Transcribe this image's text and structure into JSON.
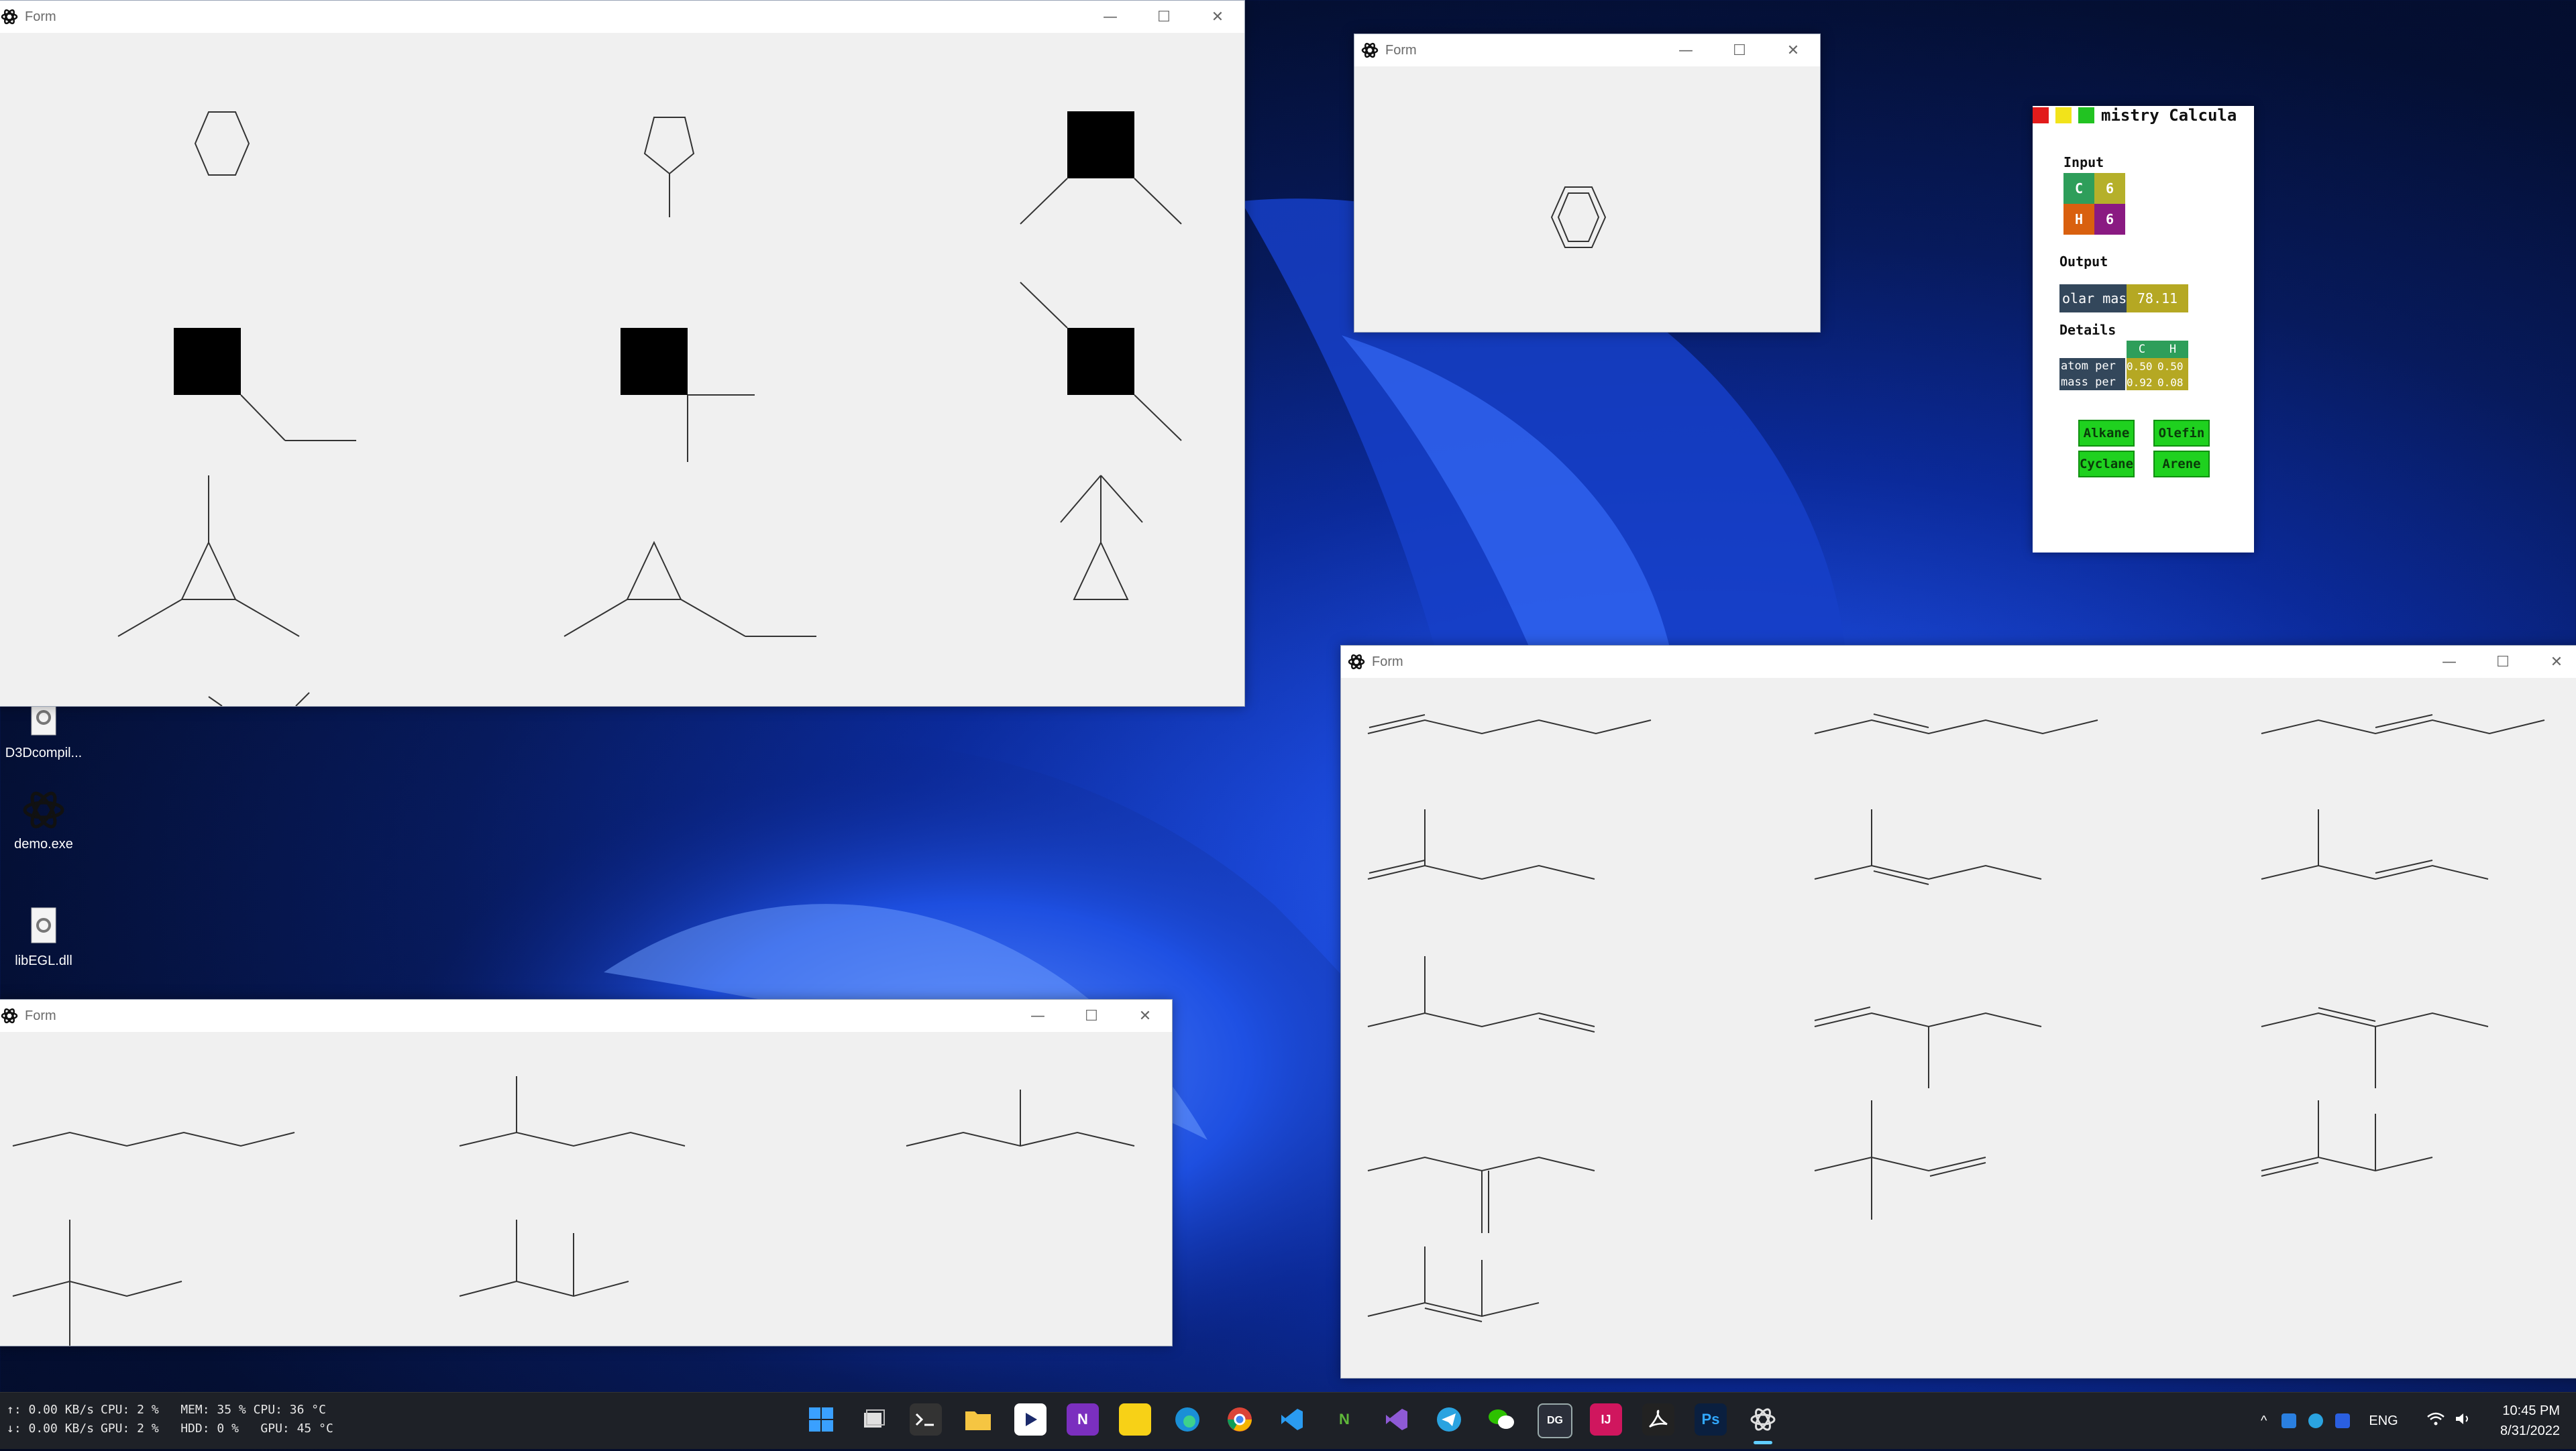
{
  "windows": {
    "w1": {
      "title": "Form",
      "controls": {
        "min": "—",
        "max": "☐",
        "close": "✕"
      }
    },
    "w2": {
      "title": "Form",
      "controls": {
        "min": "—",
        "max": "☐",
        "close": "✕"
      }
    },
    "w3": {
      "title": "Form",
      "controls": {
        "min": "—",
        "max": "☐",
        "close": "✕"
      }
    },
    "w4": {
      "title": "Form",
      "controls": {
        "min": "—",
        "max": "☐",
        "close": "✕"
      }
    }
  },
  "calculator": {
    "title": "mistry Calcula",
    "input_label": "Input",
    "input_tiles": [
      {
        "text": "C",
        "color": "#2e9e5a"
      },
      {
        "text": "6",
        "color": "#b5b02a"
      },
      {
        "text": "H",
        "color": "#d9600f"
      },
      {
        "text": "6",
        "color": "#8a1a82"
      }
    ],
    "output_label": "Output",
    "output_row": {
      "key": "olar mas",
      "value": "78.11"
    },
    "details_label": "Details",
    "details_header": {
      "c": "C",
      "h": "H"
    },
    "details_rows": [
      {
        "key": "atom per",
        "c": "0.50",
        "h": "0.50"
      },
      {
        "key": "mass per",
        "c": "0.92",
        "h": "0.08"
      }
    ],
    "buttons": {
      "alkane": "Alkane",
      "olefin": "Olefin",
      "cyclane": "Cyclane",
      "arene": "Arene"
    },
    "colors": {
      "dot1": "#e21b1b",
      "dot2": "#f2e31a",
      "dot3": "#22c322",
      "key_bg": "#33475b",
      "value_bg": "#b5a823",
      "header_bg": "#2e9e5a",
      "button": "#1fd11f"
    }
  },
  "desktop_icons": [
    {
      "label": "D3Dcompil...",
      "icon": "dll-gear-icon"
    },
    {
      "label": "demo.exe",
      "icon": "atom-icon"
    },
    {
      "label": "libEGL.dll",
      "icon": "dll-gear-icon"
    }
  ],
  "taskbar": {
    "net_stats": "↑: 0.00 KB/s\n↓: 0.00 KB/s",
    "sys_stats": "CPU: 2 %   MEM: 35 % CPU: 36 °C\nGPU: 2 %   HDD: 0 %   GPU: 45 °C",
    "apps": [
      "windows-start",
      "task-view",
      "terminal",
      "file-explorer",
      "media-player",
      "onenote",
      "sticky-notes",
      "edge",
      "chrome",
      "vscode",
      "neovim",
      "visual-studio",
      "telegram",
      "wechat",
      "dg",
      "intellij",
      "acrobat",
      "photoshop",
      "demo-app"
    ],
    "app_glyphs": {
      "onenote": "N",
      "photoshop": "Ps",
      "neovim": "N",
      "dg": "DG",
      "intellij": "IJ"
    },
    "tray": {
      "language": "ENG"
    },
    "clock": {
      "time": "10:45 PM",
      "date": "8/31/2022"
    }
  }
}
